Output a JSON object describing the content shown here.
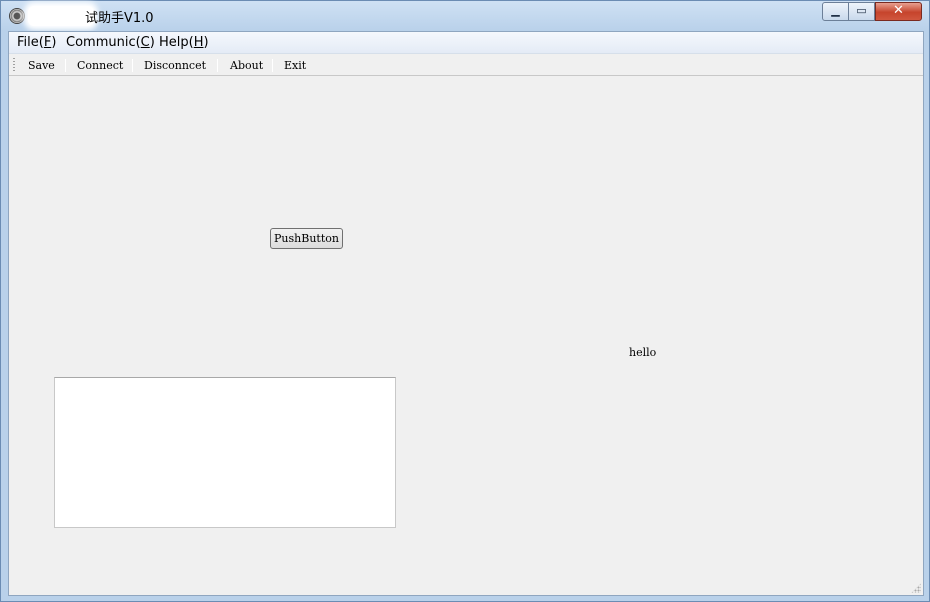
{
  "window": {
    "title": "试助手V1.0",
    "controls": {
      "minimize": "▁",
      "maximize": "▭",
      "close": "✕"
    }
  },
  "menubar": {
    "file": {
      "label": "File(",
      "mnemonic": "F",
      "suffix": ")"
    },
    "communic": {
      "label": "Communic(",
      "mnemonic": "C",
      "suffix": ")"
    },
    "help": {
      "label": "Help(",
      "mnemonic": "H",
      "suffix": ")"
    }
  },
  "toolbar": {
    "save": "Save",
    "connect": "Connect",
    "disconnect": "Disconncet",
    "about": "About",
    "exit": "Exit"
  },
  "content": {
    "push_button": "PushButton",
    "label": "hello",
    "text_edit_value": ""
  }
}
